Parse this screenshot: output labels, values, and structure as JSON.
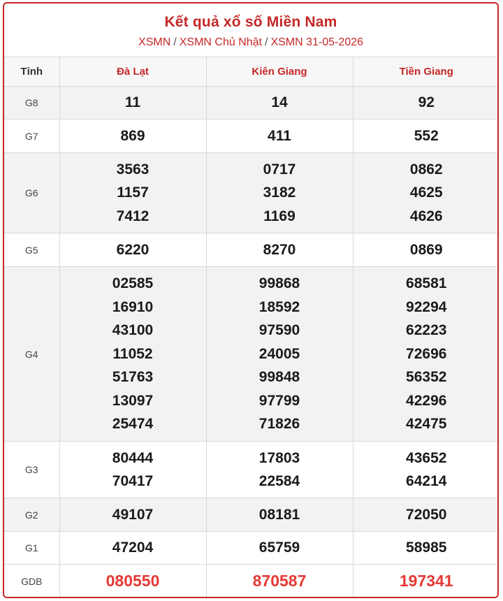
{
  "header": {
    "title": "Kết quả xổ số Miền Nam",
    "breadcrumb": [
      "XSMN",
      "XSMN Chủ Nhật",
      "XSMN 31-05-2026"
    ]
  },
  "table": {
    "label_header": "Tỉnh",
    "provinces": [
      "Đà Lạt",
      "Kiên Giang",
      "Tiền Giang"
    ],
    "prizes": {
      "g8": {
        "label": "G8",
        "values": [
          [
            "11"
          ],
          [
            "14"
          ],
          [
            "92"
          ]
        ]
      },
      "g7": {
        "label": "G7",
        "values": [
          [
            "869"
          ],
          [
            "411"
          ],
          [
            "552"
          ]
        ]
      },
      "g6": {
        "label": "G6",
        "values": [
          [
            "3563",
            "1157",
            "7412"
          ],
          [
            "0717",
            "3182",
            "1169"
          ],
          [
            "0862",
            "4625",
            "4626"
          ]
        ]
      },
      "g5": {
        "label": "G5",
        "values": [
          [
            "6220"
          ],
          [
            "8270"
          ],
          [
            "0869"
          ]
        ]
      },
      "g4": {
        "label": "G4",
        "values": [
          [
            "02585",
            "16910",
            "43100",
            "11052",
            "51763",
            "13097",
            "25474"
          ],
          [
            "99868",
            "18592",
            "97590",
            "24005",
            "99848",
            "97799",
            "71826"
          ],
          [
            "68581",
            "92294",
            "62223",
            "72696",
            "56352",
            "42296",
            "42475"
          ]
        ]
      },
      "g3": {
        "label": "G3",
        "values": [
          [
            "80444",
            "70417"
          ],
          [
            "17803",
            "22584"
          ],
          [
            "43652",
            "64214"
          ]
        ]
      },
      "g2": {
        "label": "G2",
        "values": [
          [
            "49107"
          ],
          [
            "08181"
          ],
          [
            "72050"
          ]
        ]
      },
      "g1": {
        "label": "G1",
        "values": [
          [
            "47204"
          ],
          [
            "65759"
          ],
          [
            "58985"
          ]
        ]
      },
      "db": {
        "label": "GDB",
        "values": [
          [
            "080550"
          ],
          [
            "870587"
          ],
          [
            "197341"
          ]
        ]
      }
    }
  },
  "colors": {
    "brand_red": "#c62828",
    "special_red": "#e53935",
    "shade_gray": "#f2f2f2"
  }
}
